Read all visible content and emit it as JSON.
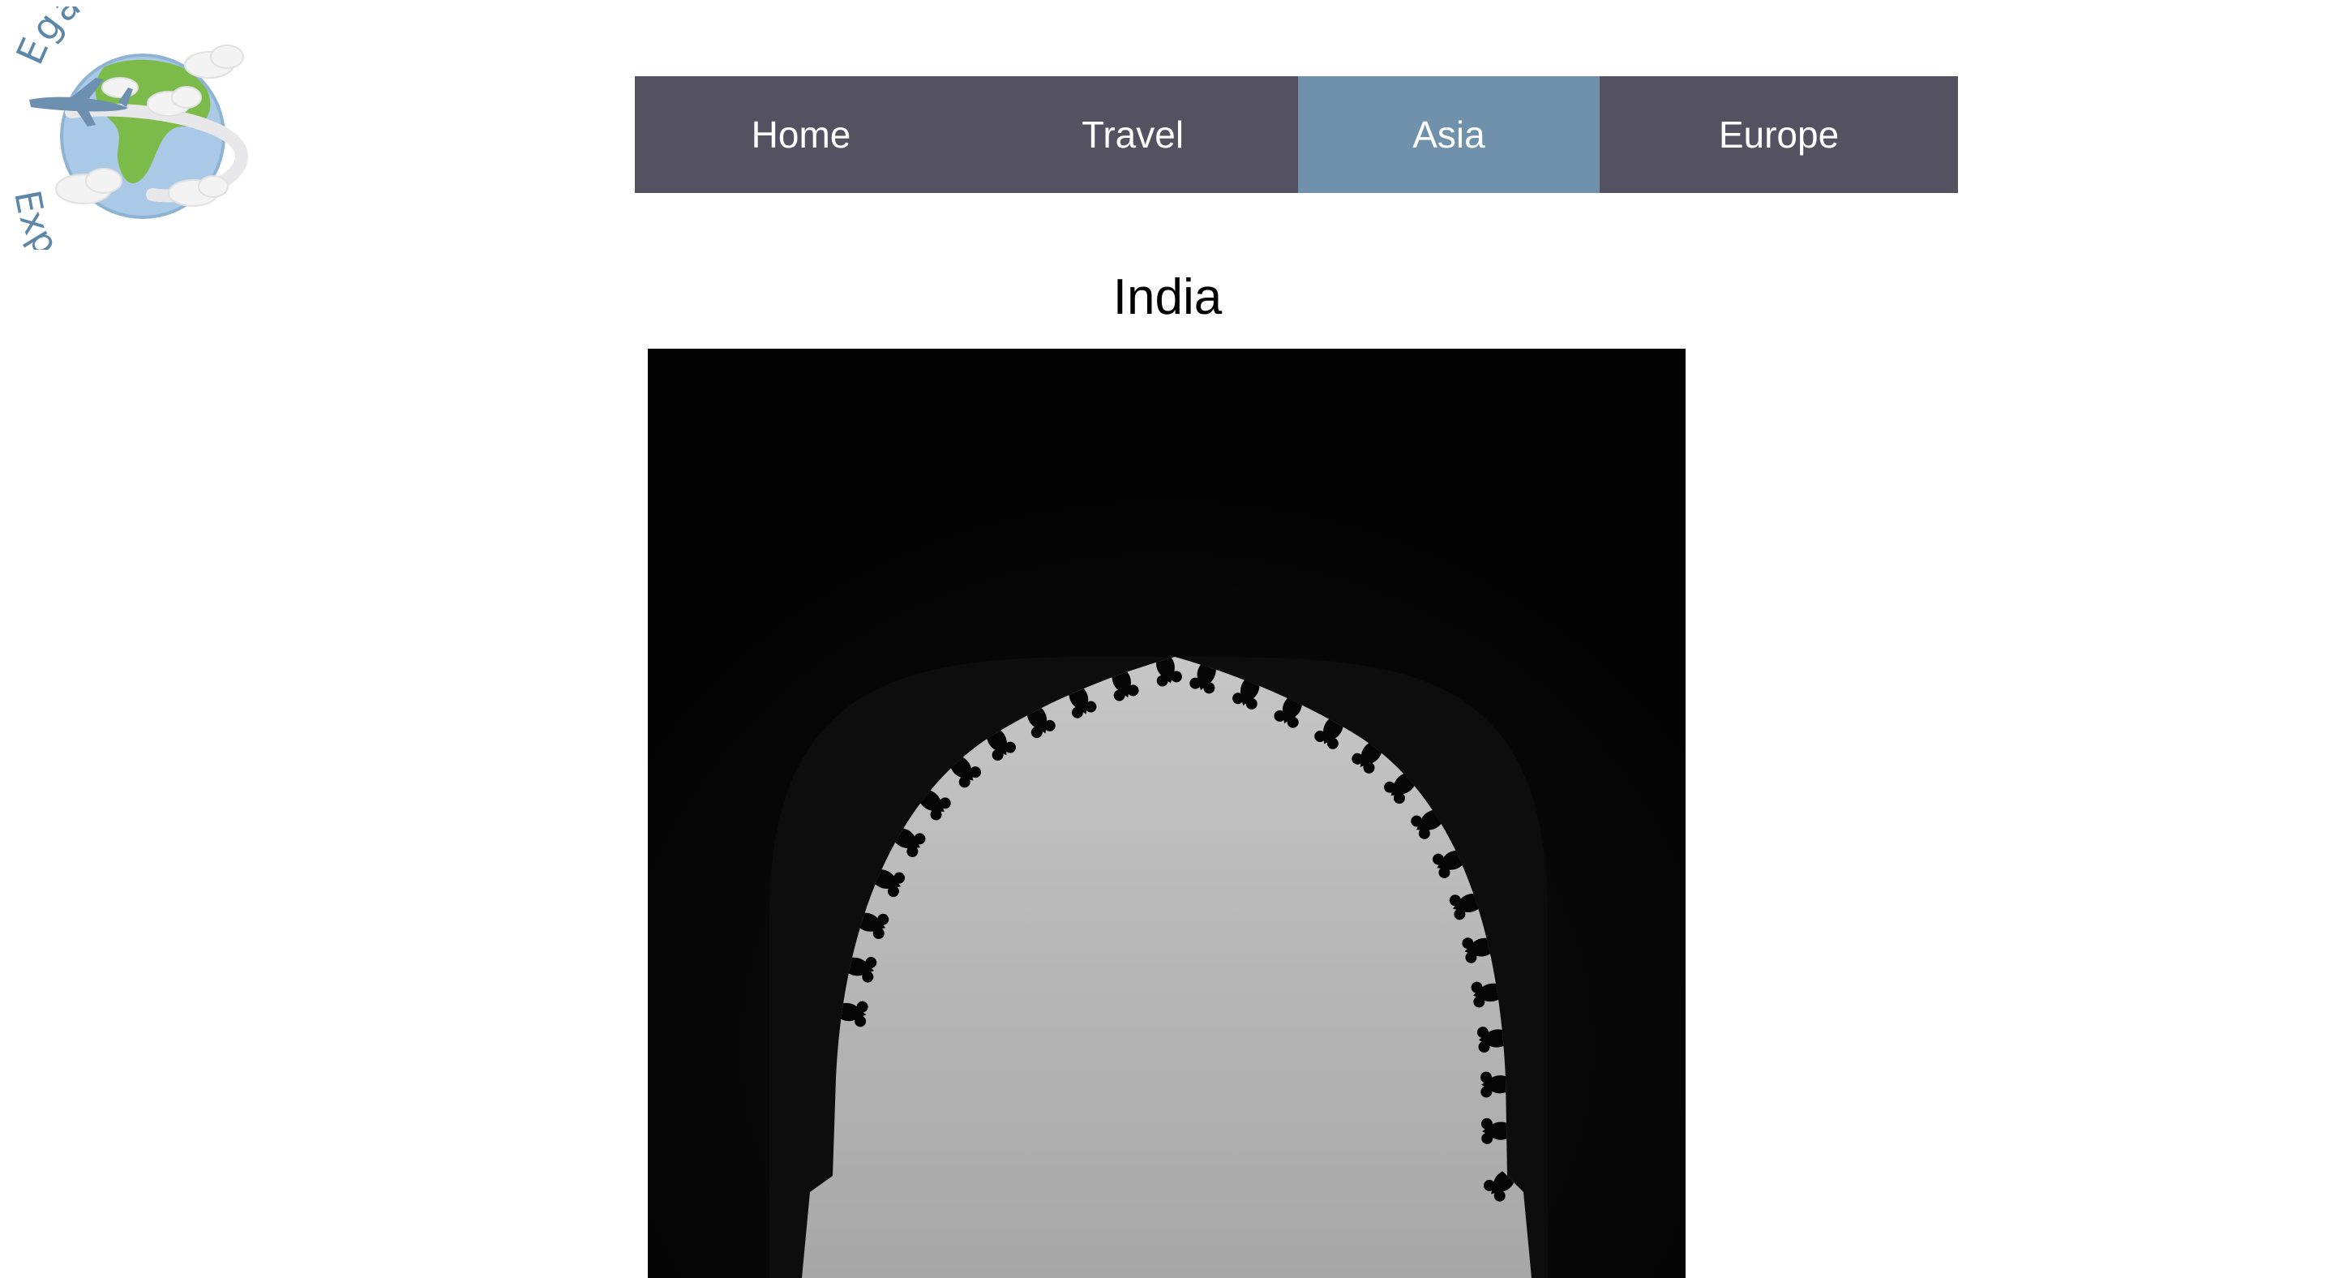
{
  "logo": {
    "line1": "Egan's",
    "line2": "Expeditions",
    "colors": {
      "text": "#5d87a8",
      "globe": "#a9c9e6",
      "land": "#7cba4a",
      "plane": "#6d8fb0",
      "cloud": "#f3f3f3"
    }
  },
  "nav": {
    "items": [
      {
        "label": "Home",
        "active": false
      },
      {
        "label": "Travel",
        "active": false
      },
      {
        "label": "Asia",
        "active": true
      },
      {
        "label": "Europe",
        "active": false
      }
    ],
    "colors": {
      "background": "#545260",
      "active": "#6f91ab",
      "text": "#ffffff"
    }
  },
  "main": {
    "title": "India"
  },
  "photo": {
    "subject": "arch-photo",
    "colors": {
      "frame": "#050505",
      "sky": "#b9b9b9"
    }
  }
}
